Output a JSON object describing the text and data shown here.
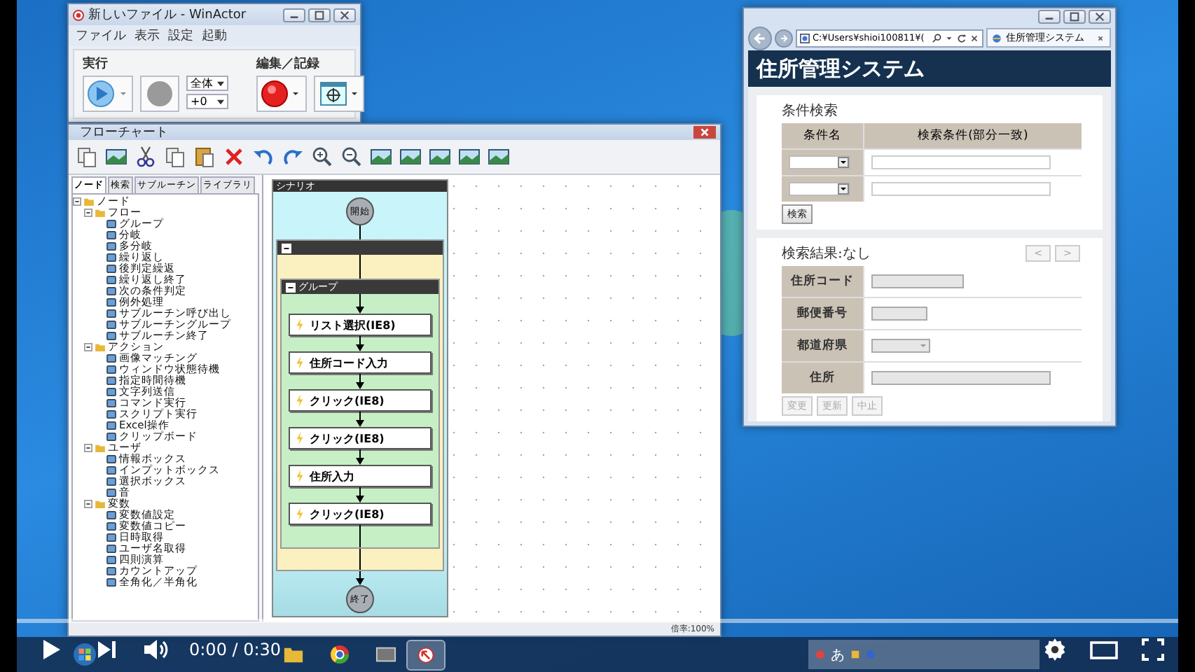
{
  "winactor": {
    "title": "新しいファイル - WinActor",
    "menu": [
      "ファイル",
      "表示",
      "設定",
      "起動"
    ],
    "run_group": {
      "label": "実行",
      "scope": "全体",
      "offset": "+0"
    },
    "edit_group": {
      "label": "編集／記録"
    }
  },
  "flowchart": {
    "title": "フローチャート",
    "tabs": [
      {
        "label": "ノード",
        "selected": true
      },
      {
        "label": "検索",
        "selected": false
      },
      {
        "label": "サブルーチン",
        "selected": false
      },
      {
        "label": "ライブラリ",
        "selected": false
      }
    ],
    "tree": [
      {
        "label": "ノード",
        "expanded": true,
        "children": [
          {
            "label": "フロー",
            "expanded": true,
            "children": [
              {
                "label": "グループ"
              },
              {
                "label": "分岐"
              },
              {
                "label": "多分岐"
              },
              {
                "label": "繰り返し"
              },
              {
                "label": "後判定繰返"
              },
              {
                "label": "繰り返し終了"
              },
              {
                "label": "次の条件判定"
              },
              {
                "label": "例外処理"
              },
              {
                "label": "サブルーチン呼び出し"
              },
              {
                "label": "サブルーチングループ"
              },
              {
                "label": "サブルーチン終了"
              }
            ]
          },
          {
            "label": "アクション",
            "expanded": true,
            "children": [
              {
                "label": "画像マッチング"
              },
              {
                "label": "ウィンドウ状態待機"
              },
              {
                "label": "指定時間待機"
              },
              {
                "label": "文字列送信"
              },
              {
                "label": "コマンド実行"
              },
              {
                "label": "スクリプト実行"
              },
              {
                "label": "Excel操作"
              },
              {
                "label": "クリップボード"
              }
            ]
          },
          {
            "label": "ユーザ",
            "expanded": true,
            "children": [
              {
                "label": "情報ボックス"
              },
              {
                "label": "インプットボックス"
              },
              {
                "label": "選択ボックス"
              },
              {
                "label": "音"
              }
            ]
          },
          {
            "label": "変数",
            "expanded": true,
            "children": [
              {
                "label": "変数値設定"
              },
              {
                "label": "変数値コピー"
              },
              {
                "label": "日時取得"
              },
              {
                "label": "ユーザ名取得"
              },
              {
                "label": "四則演算"
              },
              {
                "label": "カウントアップ"
              },
              {
                "label": "全角化／半角化"
              }
            ]
          }
        ]
      }
    ],
    "scenario": {
      "title": "シナリオ",
      "start": "開始",
      "end": "終了",
      "outer_group": {
        "expanded": true
      },
      "group": {
        "title": "グループ",
        "expanded": true,
        "steps": [
          "リスト選択(IE8)",
          "住所コード入力",
          "クリック(IE8)",
          "クリック(IE8)",
          "住所入力",
          "クリック(IE8)"
        ]
      }
    },
    "zoom": "倍率:100%"
  },
  "browser": {
    "address": "C:¥Users¥shioi100811¥(",
    "tab": "住所管理システム",
    "app_title": "住所管理システム",
    "search": {
      "heading": "条件検索",
      "columns": [
        "条件名",
        "検索条件(部分一致)"
      ],
      "rows": [
        {
          "kind": "select-and-text"
        },
        {
          "kind": "select-and-text"
        }
      ],
      "button": "検索"
    },
    "results": {
      "heading": "検索結果:なし",
      "pager": [
        {
          "label": "<",
          "disabled": true
        },
        {
          "label": ">",
          "disabled": true
        }
      ],
      "fields": [
        {
          "label": "住所コード",
          "kind": "text",
          "disabled": true
        },
        {
          "label": "郵便番号",
          "kind": "short",
          "disabled": true
        },
        {
          "label": "都道府県",
          "kind": "select",
          "disabled": true
        },
        {
          "label": "住所",
          "kind": "wide",
          "disabled": true
        }
      ],
      "buttons": [
        {
          "label": "変更",
          "disabled": true
        },
        {
          "label": "更新",
          "disabled": true
        },
        {
          "label": "中止",
          "disabled": true
        }
      ]
    }
  },
  "taskbar": {
    "ime_mode": "あ"
  },
  "player": {
    "time": "0:00 / 0:30",
    "progress": {
      "level": 0
    }
  }
}
